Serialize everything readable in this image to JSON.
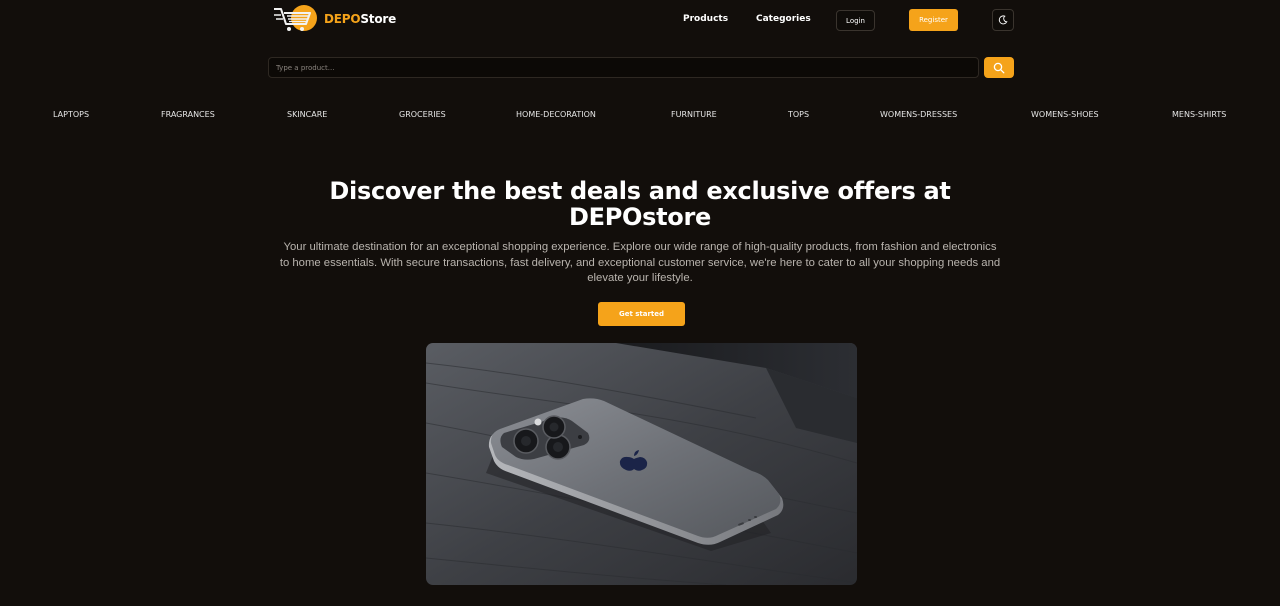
{
  "brand": {
    "name_prefix": "DEPO",
    "name_suffix": "Store"
  },
  "header": {
    "nav": [
      "Products",
      "Categories"
    ],
    "login_label": "Login",
    "register_label": "Register",
    "theme_icon": "moon-icon"
  },
  "search": {
    "placeholder": "Type a product...",
    "value": "",
    "icon": "search-icon"
  },
  "categories": [
    "laptops",
    "fragrances",
    "skincare",
    "groceries",
    "home-decoration",
    "furniture",
    "tops",
    "womens-dresses",
    "womens-shoes",
    "mens-shirts"
  ],
  "hero": {
    "title": "Discover the best deals and exclusive offers at DEPOstore",
    "description": "Your ultimate destination for an exceptional shopping experience. Explore our wide range of high-quality products, from fashion and electronics to home essentials. With secure transactions, fast delivery, and exceptional customer service, we're here to cater to all your shopping needs and elevate your lifestyle.",
    "cta_label": "Get started",
    "image": "smartphone-on-wooden-table"
  },
  "colors": {
    "accent": "#f5a31a",
    "background": "#120e0b"
  }
}
